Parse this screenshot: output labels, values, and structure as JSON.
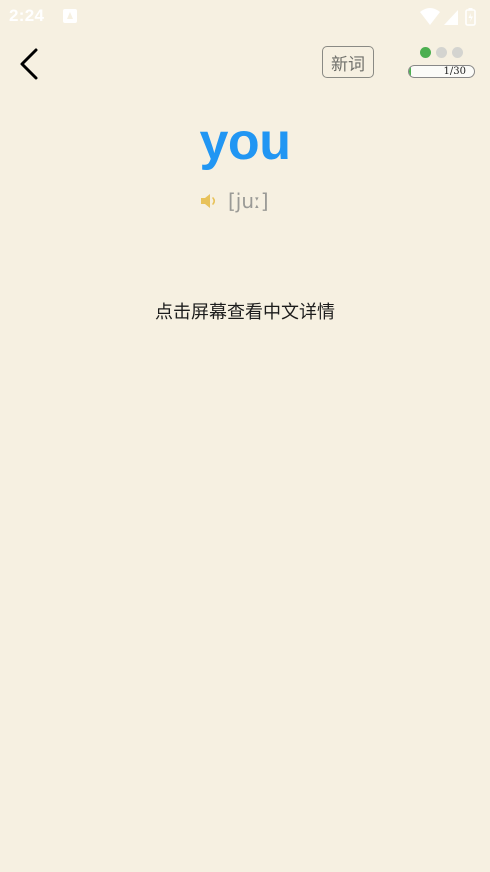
{
  "status_bar": {
    "time": "2:24",
    "icons": [
      "notification-icon",
      "wifi-icon",
      "signal-icon",
      "battery-icon"
    ]
  },
  "header": {
    "back_icon": "back-chevron-icon",
    "new_word_label": "新词",
    "progress": {
      "dots_total": 3,
      "dots_active": 1,
      "current": 1,
      "total": 30,
      "label": "1/30"
    }
  },
  "card": {
    "word": "you",
    "phonetic": "[juː]",
    "speaker_icon": "speaker-icon",
    "hint": "点击屏幕查看中文详情"
  },
  "colors": {
    "background": "#f6f0e1",
    "word": "#2196f3",
    "progress": "#4caf50",
    "speaker": "#e8c25a"
  }
}
